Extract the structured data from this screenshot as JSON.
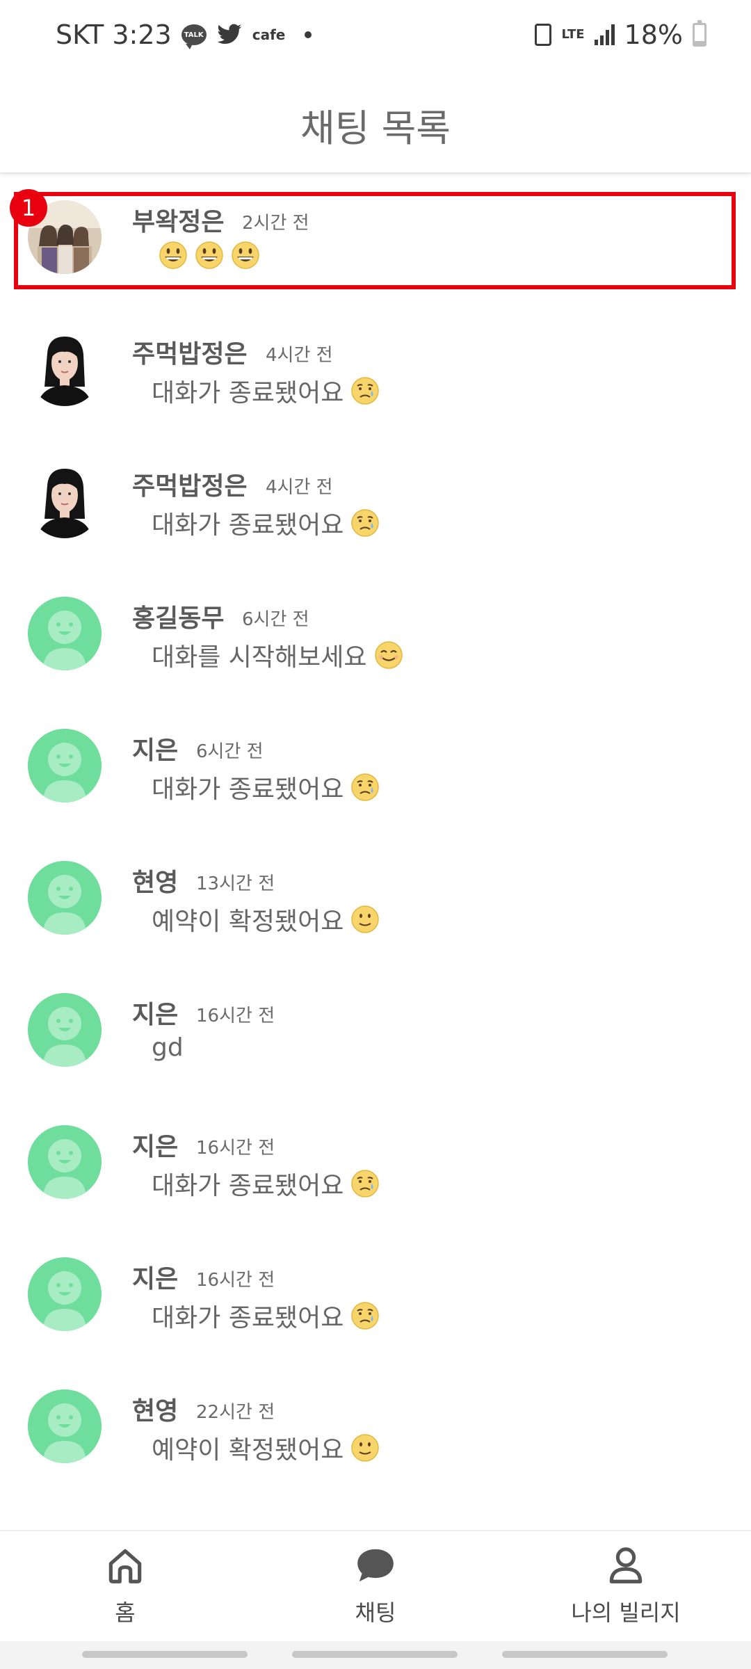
{
  "status_bar": {
    "carrier_time": "SKT 3:23",
    "talk_label": "TALK",
    "cafe_label": "cafe",
    "lte_label": "LTE",
    "battery_text": "18%",
    "battery_level": 0.18
  },
  "header": {
    "title": "채팅 목록"
  },
  "chats": [
    {
      "name": "부왁정은",
      "time": "2시간 전",
      "message": "",
      "avatar": "photo-group",
      "emojis": [
        "grinning",
        "grinning",
        "grinning"
      ],
      "unread": "1",
      "highlighted": true
    },
    {
      "name": "주먹밥정은",
      "time": "4시간 전",
      "message": "대화가 종료됐어요",
      "avatar": "photo-portrait",
      "emojis": [
        "sad"
      ]
    },
    {
      "name": "주먹밥정은",
      "time": "4시간 전",
      "message": "대화가 종료됐어요",
      "avatar": "photo-portrait",
      "emojis": [
        "sad"
      ]
    },
    {
      "name": "홍길동무",
      "time": "6시간 전",
      "message": "대화를 시작해보세요",
      "avatar": "default",
      "emojis": [
        "smile"
      ]
    },
    {
      "name": "지은",
      "time": "6시간 전",
      "message": "대화가 종료됐어요",
      "avatar": "default",
      "emojis": [
        "sad"
      ]
    },
    {
      "name": "현영",
      "time": "13시간 전",
      "message": "예약이 확정됐어요",
      "avatar": "default",
      "emojis": [
        "slight-smile"
      ]
    },
    {
      "name": "지은",
      "time": "16시간 전",
      "message": "gd",
      "avatar": "default",
      "emojis": []
    },
    {
      "name": "지은",
      "time": "16시간 전",
      "message": "대화가 종료됐어요",
      "avatar": "default",
      "emojis": [
        "sad"
      ]
    },
    {
      "name": "지은",
      "time": "16시간 전",
      "message": "대화가 종료됐어요",
      "avatar": "default",
      "emojis": [
        "sad"
      ]
    },
    {
      "name": "현영",
      "time": "22시간 전",
      "message": "예약이 확정됐어요",
      "avatar": "default",
      "emojis": [
        "slight-smile"
      ]
    }
  ],
  "bottom_nav": {
    "home_label": "홈",
    "chat_label": "채팅",
    "village_label": "나의 빌리지"
  },
  "colors": {
    "accent_green": "#6fdd9c",
    "highlight_red": "#e8000e"
  }
}
